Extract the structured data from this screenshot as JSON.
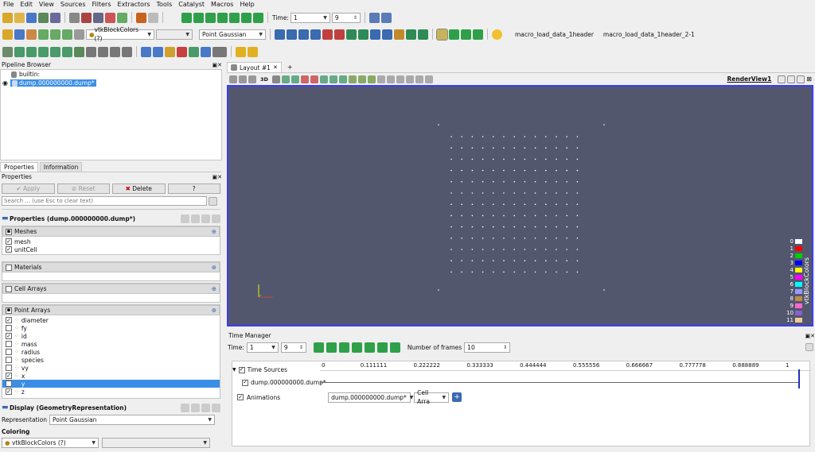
{
  "menu": [
    "File",
    "Edit",
    "View",
    "Sources",
    "Filters",
    "Extractors",
    "Tools",
    "Catalyst",
    "Macros",
    "Help"
  ],
  "toolbar": {
    "time_label": "Time:",
    "time_value": "1",
    "time_index": "9",
    "coloring_combo": "vtkBlockColors (?)",
    "representation_combo": "Point Gaussian",
    "macro_1": "macro_load_data_1header",
    "macro_2": "macro_load_data_1header_2-1"
  },
  "pipeline": {
    "title": "Pipeline Browser",
    "root": "builtin:",
    "source": "dump.000000000.dump*"
  },
  "tabs": {
    "properties": "Properties",
    "information": "Information"
  },
  "properties": {
    "title": "Properties",
    "apply": "Apply",
    "reset": "Reset",
    "delete": "Delete",
    "help": "?",
    "search_placeholder": "Search ... (use Esc to clear text)",
    "section_title": "Properties (dump.000000000.dump*)",
    "meshes_label": "Meshes",
    "meshes": [
      {
        "label": "mesh",
        "checked": true
      },
      {
        "label": "unitCell",
        "checked": true
      }
    ],
    "materials_label": "Materials",
    "cell_arrays_label": "Cell Arrays",
    "point_arrays_label": "Point Arrays",
    "point_arrays": [
      {
        "label": "diameter",
        "checked": true
      },
      {
        "label": "fy",
        "checked": false
      },
      {
        "label": "id",
        "checked": true
      },
      {
        "label": "mass",
        "checked": false
      },
      {
        "label": "radius",
        "checked": false
      },
      {
        "label": "species",
        "checked": false
      },
      {
        "label": "vy",
        "checked": false
      },
      {
        "label": "x",
        "checked": true
      },
      {
        "label": "y",
        "checked": true,
        "selected": true
      },
      {
        "label": "z",
        "checked": true
      }
    ],
    "display_title": "Display (GeometryRepresentation)",
    "representation_label": "Representation",
    "representation_value": "Point Gaussian",
    "coloring_label": "Coloring",
    "coloring_value": "vtkBlockColors (?)"
  },
  "layout": {
    "tab_label": "Layout #1",
    "add_tab": "+",
    "view_name": "RenderView1",
    "view_3d": "3D"
  },
  "legend": {
    "title": "vtkBlockColors",
    "entries": [
      {
        "label": "0",
        "color": "#ffffff"
      },
      {
        "label": "1",
        "color": "#ff0000"
      },
      {
        "label": "2",
        "color": "#00cc00"
      },
      {
        "label": "3",
        "color": "#0000ff"
      },
      {
        "label": "4",
        "color": "#ffff00"
      },
      {
        "label": "5",
        "color": "#ff00ff"
      },
      {
        "label": "6",
        "color": "#00ffff"
      },
      {
        "label": "7",
        "color": "#9999ff"
      },
      {
        "label": "8",
        "color": "#c08a4a"
      },
      {
        "label": "9",
        "color": "#ff66cc"
      },
      {
        "label": "10",
        "color": "#8a5fd0"
      },
      {
        "label": "11",
        "color": "#f5c89a"
      }
    ]
  },
  "time_manager": {
    "title": "Time Manager",
    "time_label": "Time:",
    "time_value": "1",
    "time_index": "9",
    "frames_label": "Number of frames",
    "frames_value": "10",
    "ticks": [
      "0",
      "0.111111",
      "0.222222",
      "0.333333",
      "0.444444",
      "0.555556",
      "0.666667",
      "0.777778",
      "0.888889",
      "1"
    ],
    "time_sources_label": "Time Sources",
    "source_label": "dump.000000000.dump*",
    "animations_label": "Animations",
    "anim_source": "dump.000000000.dump*",
    "anim_property": "Cell Arra"
  }
}
